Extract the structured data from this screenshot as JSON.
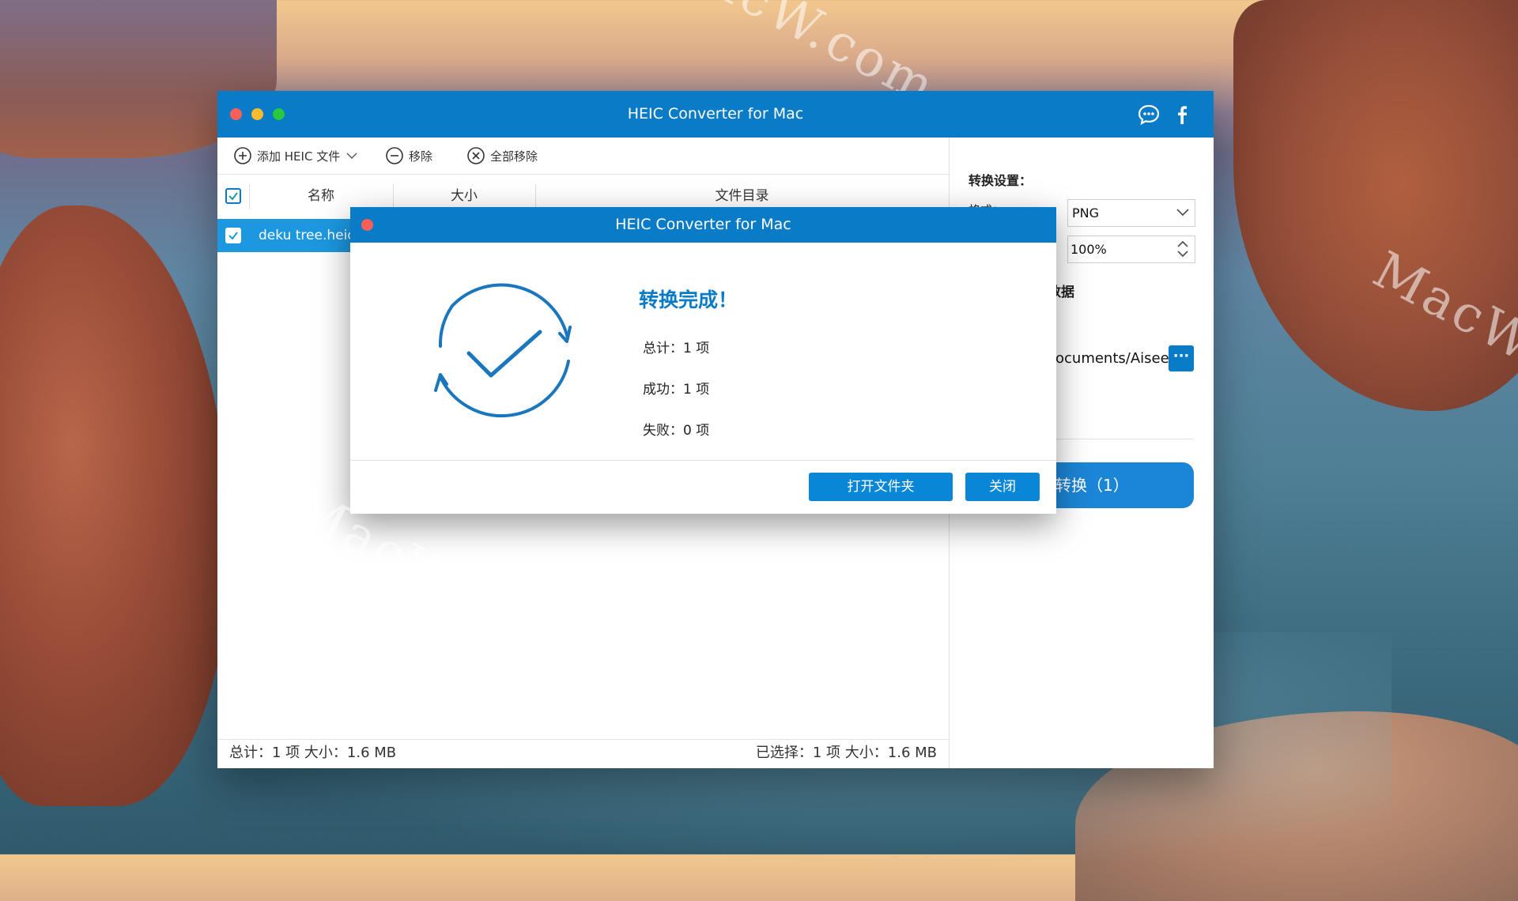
{
  "watermark": "MacW.com",
  "window": {
    "title": "HEIC Converter for Mac",
    "toolbar": {
      "add_label": "添加 HEIC 文件",
      "remove_label": "移除",
      "remove_all_label": "全部移除"
    },
    "table": {
      "headers": [
        "名称",
        "大小",
        "文件目录"
      ],
      "rows": [
        {
          "name": "deku tree.heic",
          "checked": true
        }
      ]
    },
    "status": {
      "left": "总计：1 项 大小：1.6 MB",
      "right": "已选择：1 项 大小：1.6 MB"
    },
    "settings": {
      "title": "转换设置：",
      "format_label": "格式：",
      "format_value": "PNG",
      "quality_value": "100%",
      "metadata_label": "数据",
      "output_path": "ocuments/Aiseesoft",
      "browse_label": "···",
      "convert_label": "转换（1）"
    }
  },
  "dialog": {
    "title": "HEIC Converter for Mac",
    "heading": "转换完成！",
    "total": "总计：1 项",
    "success": "成功：1 项",
    "failed": "失败：0 项",
    "open_folder_label": "打开文件夹",
    "close_label": "关闭"
  },
  "colors": {
    "accent": "#0a7cc7",
    "selection": "#1c98e0"
  }
}
